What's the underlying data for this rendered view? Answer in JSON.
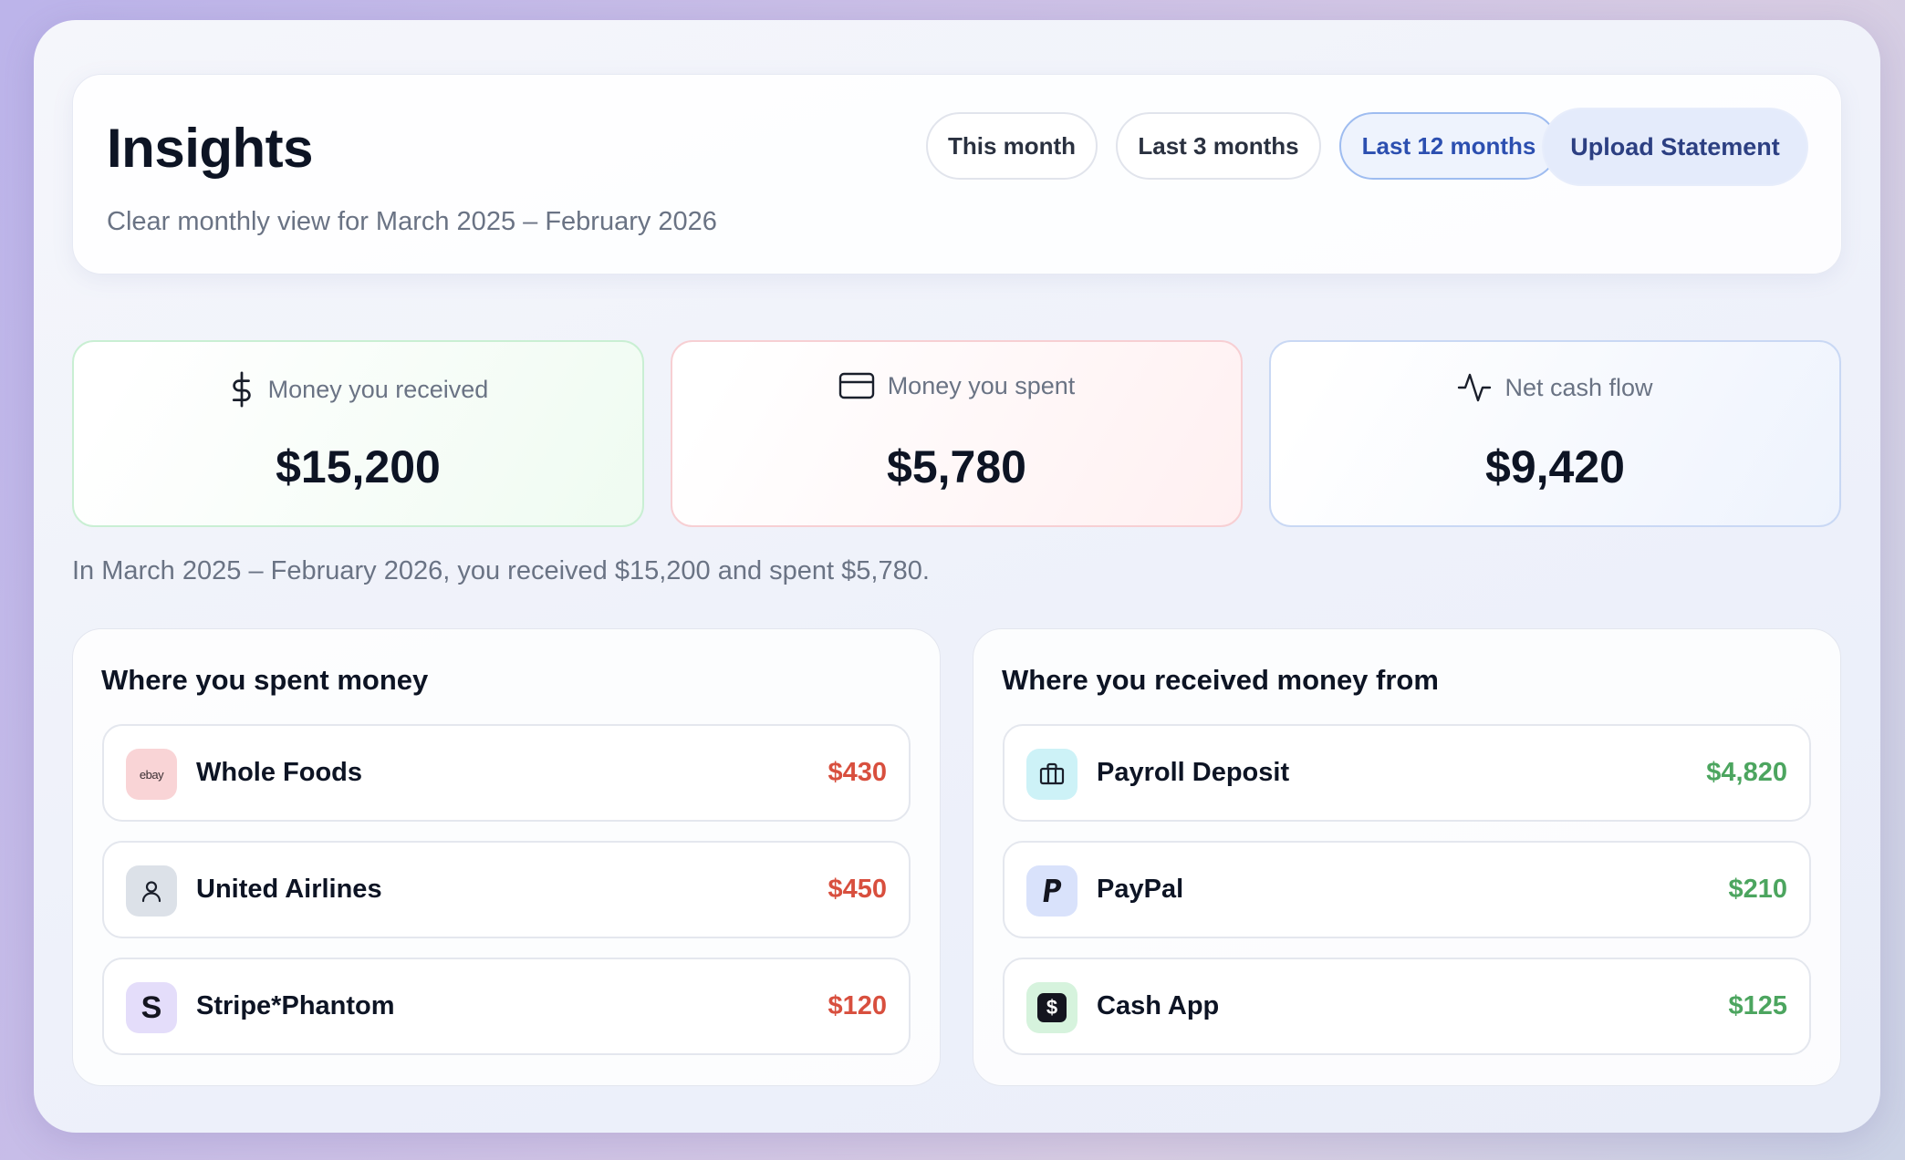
{
  "header": {
    "title": "Insights",
    "subtitle": "Clear monthly view for March 2025 – February 2026",
    "ranges": [
      "This month",
      "Last 3 months",
      "Last 12 months"
    ],
    "active_range": "Last 12 months",
    "upload_label": "Upload Statement"
  },
  "stats": {
    "received": {
      "label": "Money you received",
      "value": "$15,200",
      "icon": "dollar-icon"
    },
    "spent": {
      "label": "Money you spent",
      "value": "$5,780",
      "icon": "credit-card-icon"
    },
    "net": {
      "label": "Net cash flow",
      "value": "$9,420",
      "icon": "activity-icon"
    }
  },
  "summary": "In March 2025 – February 2026, you received $15,200 and spent $5,780.",
  "spent_panel": {
    "title": "Where you spent money",
    "items": [
      {
        "name": "Whole Foods",
        "amount": "$430",
        "logo_text": "ebay",
        "icon": "ebay-logo-icon"
      },
      {
        "name": "United Airlines",
        "amount": "$450",
        "icon": "user-icon"
      },
      {
        "name": "Stripe*Phantom",
        "amount": "$120",
        "logo_text": "S",
        "icon": "stripe-icon"
      }
    ]
  },
  "received_panel": {
    "title": "Where you received money from",
    "items": [
      {
        "name": "Payroll Deposit",
        "amount": "$4,820",
        "icon": "briefcase-icon"
      },
      {
        "name": "PayPal",
        "amount": "$210",
        "icon": "paypal-icon"
      },
      {
        "name": "Cash App",
        "amount": "$125",
        "logo_text": "$",
        "icon": "cash-app-icon"
      }
    ]
  },
  "colors": {
    "accent": "#2c4fb0",
    "negative": "#d84f3e",
    "positive": "#4ca55f",
    "text": "#0d1424",
    "muted": "#6a7384"
  }
}
